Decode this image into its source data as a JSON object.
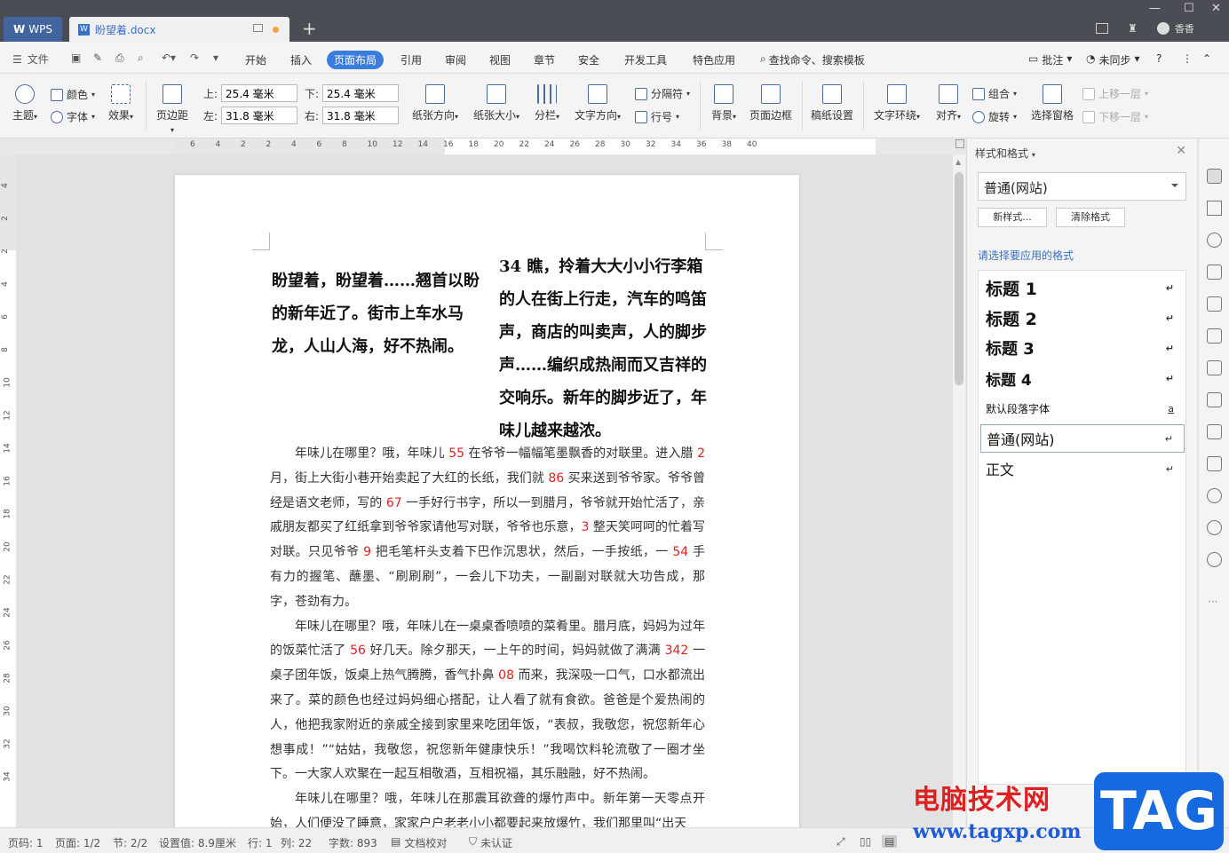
{
  "titlebar": {
    "app_tab": "WPS",
    "doc_tab": "盼望着.docx",
    "user_name": "香香"
  },
  "menubar": {
    "file": "文件",
    "items": [
      "开始",
      "插入",
      "页面布局",
      "引用",
      "审阅",
      "视图",
      "章节",
      "安全",
      "开发工具",
      "特色应用"
    ],
    "active_item": "页面布局",
    "search": "查找命令、搜索模板",
    "annotate": "批注",
    "sync": "未同步"
  },
  "ribbon": {
    "theme": "主题",
    "color": "颜色",
    "font": "字体",
    "effect": "效果",
    "margins": "页边距",
    "margin_top_label": "上:",
    "margin_top_value": "25.4 毫米",
    "margin_bottom_label": "下:",
    "margin_bottom_value": "25.4 毫米",
    "margin_left_label": "左:",
    "margin_left_value": "31.8 毫米",
    "margin_right_label": "右:",
    "margin_right_value": "31.8 毫米",
    "orientation": "纸张方向",
    "paper_size": "纸张大小",
    "columns": "分栏",
    "text_direction": "文字方向",
    "separator": "分隔符",
    "line_number": "行号",
    "background": "背景",
    "page_border": "页面边框",
    "manuscript": "稿纸设置",
    "text_wrap": "文字环绕",
    "align": "对齐",
    "group": "组合",
    "rotate": "旋转",
    "selection_pane": "选择窗格",
    "bring_forward": "上移一层",
    "send_backward": "下移一层"
  },
  "ruler": {
    "h_ticks": [
      "6",
      "4",
      "2",
      "2",
      "4",
      "6",
      "8",
      "10",
      "12",
      "14",
      "16",
      "18",
      "20",
      "22",
      "24",
      "26",
      "28",
      "30",
      "32",
      "34",
      "36",
      "38",
      "40"
    ],
    "v_ticks": [
      "4",
      "2",
      "2",
      "4",
      "6",
      "8",
      "10",
      "12",
      "14",
      "16",
      "18",
      "20",
      "22",
      "24",
      "26",
      "28",
      "30",
      "32",
      "34"
    ]
  },
  "document": {
    "col1_heading": "盼望着，盼望着……翘首以盼的新年近了。街市上车水马龙，人山人海，好不热闹。",
    "col2_heading": "34 瞧，拎着大大小小行李箱的人在街上行走，汽车的鸣笛声，商店的叫卖声，人的脚步声……编织成热闹而又吉祥的交响乐。新年的脚步近了，年味儿越来越浓。",
    "p1": [
      {
        "t": "年味儿在哪里？哦，年味儿 "
      },
      {
        "t": "55",
        "red": true
      },
      {
        "t": " 在爷爷一幅幅笔墨飘香的对联里。进入腊 "
      },
      {
        "t": "2",
        "red": true
      },
      {
        "t": " 月，街上大街小巷开始卖起了大红的长纸，我们就 "
      },
      {
        "t": "86",
        "red": true
      },
      {
        "t": " 买来送到爷爷家。爷爷曾经是语文老师，写的 "
      },
      {
        "t": "67",
        "red": true
      },
      {
        "t": " 一手好行书字，所以一到腊月，爷爷就开始忙活了，亲戚朋友都买了红纸拿到爷爷家请他写对联，爷爷也乐意，"
      },
      {
        "t": "3",
        "red": true
      },
      {
        "t": " 整天笑呵呵的忙着写对联。只见爷爷 "
      },
      {
        "t": "9",
        "red": true
      },
      {
        "t": " 把毛笔杆头支着下巴作沉思状，然后，一手按纸，一 "
      },
      {
        "t": "54",
        "red": true
      },
      {
        "t": " 手有力的握笔、蘸墨、“刷刷刷”，一会儿下功夫，一副副对联就大功告成，那字，苍劲有力。"
      }
    ],
    "p2": [
      {
        "t": "年味儿在哪里？哦，年味儿在一桌桌香喷喷的菜肴里。腊月底，妈妈为过年的饭菜忙活了 "
      },
      {
        "t": "56",
        "red": true
      },
      {
        "t": " 好几天。除夕那天，一上午的时间，妈妈就做了满满 "
      },
      {
        "t": "342",
        "red": true
      },
      {
        "t": " 一桌子团年饭，饭桌上热气腾腾，香气扑鼻 "
      },
      {
        "t": "08",
        "red": true
      },
      {
        "t": " 而来，我深吸一口气，口水都流出来了。菜的颜色也经过妈妈细心搭配，让人看了就有食欲。爸爸是个爱热闹的人，他把我家附近的亲戚全接到家里来吃团年饭，“表叔，我敬您，祝您新年心想事成！”“姑姑，我敬您，祝您新年健康快乐！”我喝饮料轮流敬了一圈才坐下。一大家人欢聚在一起互相敬酒，互相祝福，其乐融融，好不热闹。"
      }
    ],
    "p3": [
      {
        "t": "年味儿在哪里？哦，年味儿在那震耳欲聋的爆竹声中。新年第一天零点开始，人们便没了睡意，家家户户老老小小都要起来放爆竹，我们那里叫“出天"
      }
    ]
  },
  "panel": {
    "title": "样式和格式",
    "current_style": "普通(网站)",
    "new_style_btn": "新样式...",
    "clear_format_btn": "清除格式",
    "apply_label": "请选择要应用的格式",
    "styles": [
      "标题  1",
      "标题  2",
      "标题  3",
      "标题  4",
      "默认段落字体",
      "普通(网站)",
      "正文"
    ],
    "selected_style": "普通(网站)"
  },
  "statusbar": {
    "page_no": "页码: 1",
    "pages": "页面: 1/2",
    "section": "节: 2/2",
    "setting": "设置值: 8.9厘米",
    "line": "行: 1",
    "col": "列: 22",
    "word_count": "字数: 893",
    "proofread": "文档校对",
    "auth": "未认证"
  },
  "watermark": {
    "site_name": "电脑技术网",
    "url": "www.tagxp.com",
    "tag": "TAG"
  }
}
